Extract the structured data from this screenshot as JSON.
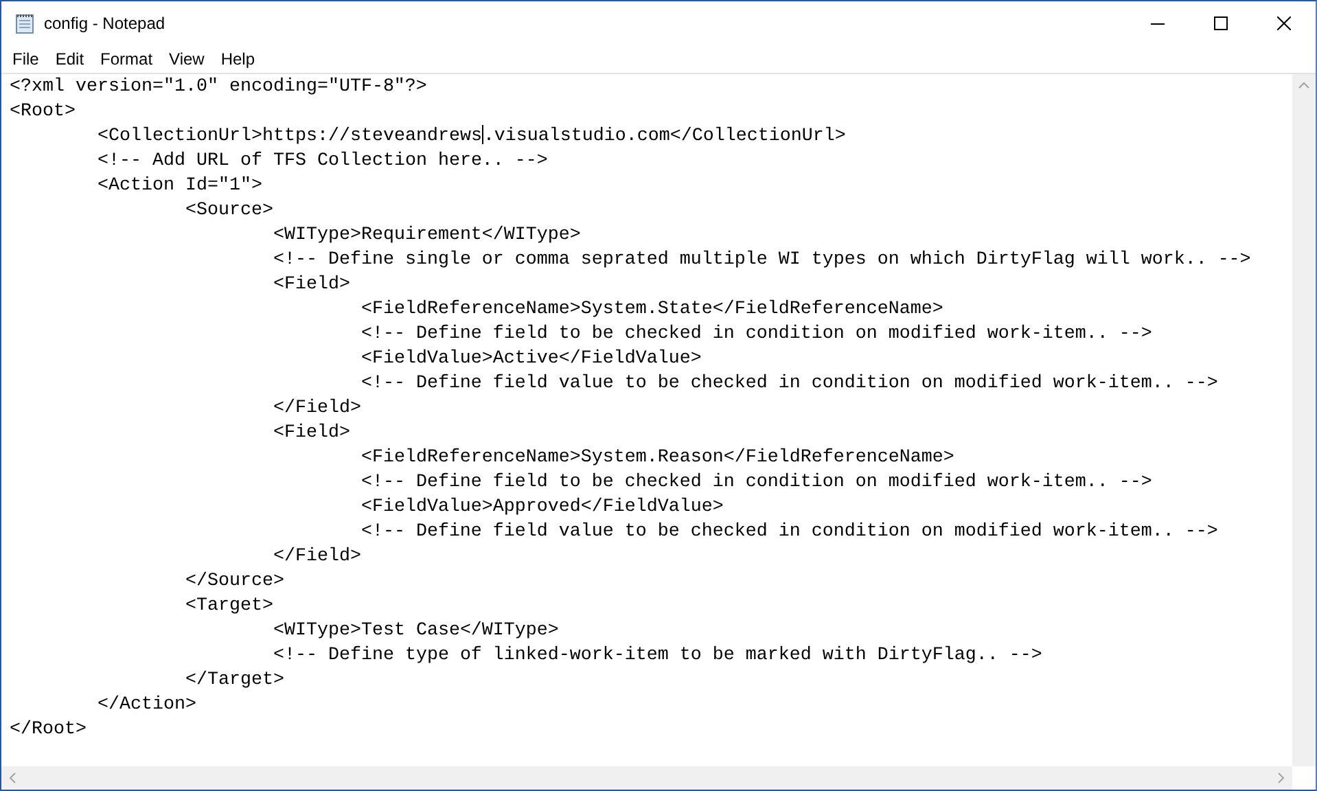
{
  "window": {
    "title": "config - Notepad"
  },
  "menu": [
    "File",
    "Edit",
    "Format",
    "View",
    "Help"
  ],
  "editor": {
    "lines": [
      {
        "text": "<?xml version=\"1.0\" encoding=\"UTF-8\"?>"
      },
      {
        "text": "<Root>"
      },
      {
        "before_caret": "\t<CollectionUrl>https://steveandrews",
        "after_caret": ".visualstudio.com</CollectionUrl>"
      },
      {
        "text": "\t<!-- Add URL of TFS Collection here.. -->"
      },
      {
        "text": "\t<Action Id=\"1\">"
      },
      {
        "text": "\t\t<Source>"
      },
      {
        "text": "\t\t\t<WIType>Requirement</WIType>"
      },
      {
        "text": "\t\t\t<!-- Define single or comma seprated multiple WI types on which DirtyFlag will work.. -->"
      },
      {
        "text": "\t\t\t<Field>"
      },
      {
        "text": "\t\t\t\t<FieldReferenceName>System.State</FieldReferenceName>"
      },
      {
        "text": "\t\t\t\t<!-- Define field to be checked in condition on modified work-item.. -->"
      },
      {
        "text": "\t\t\t\t<FieldValue>Active</FieldValue>"
      },
      {
        "text": "\t\t\t\t<!-- Define field value to be checked in condition on modified work-item.. -->"
      },
      {
        "text": "\t\t\t</Field>"
      },
      {
        "text": "\t\t\t<Field>"
      },
      {
        "text": "\t\t\t\t<FieldReferenceName>System.Reason</FieldReferenceName>"
      },
      {
        "text": "\t\t\t\t<!-- Define field to be checked in condition on modified work-item.. -->"
      },
      {
        "text": "\t\t\t\t<FieldValue>Approved</FieldValue>"
      },
      {
        "text": "\t\t\t\t<!-- Define field value to be checked in condition on modified work-item.. -->"
      },
      {
        "text": "\t\t\t</Field>"
      },
      {
        "text": "\t\t</Source>"
      },
      {
        "text": "\t\t<Target>"
      },
      {
        "text": "\t\t\t<WIType>Test Case</WIType>"
      },
      {
        "text": "\t\t\t<!-- Define type of linked-work-item to be marked with DirtyFlag.. -->"
      },
      {
        "text": "\t\t</Target>"
      },
      {
        "text": "\t</Action>"
      },
      {
        "text": "</Root>"
      }
    ]
  }
}
